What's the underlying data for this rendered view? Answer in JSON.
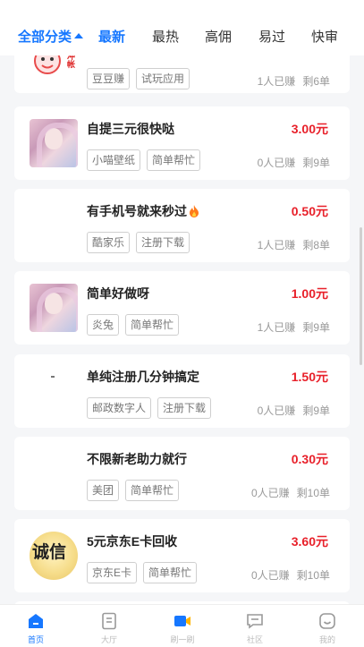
{
  "tabs": {
    "category_label": "全部分类",
    "items": [
      "最新",
      "最热",
      "高佣",
      "易过",
      "快审"
    ]
  },
  "tasks": [
    {
      "title": "",
      "price": "",
      "tags": [
        "豆豆赚",
        "试玩应用"
      ],
      "earned": "1人已赚",
      "remaining": "剩6单",
      "thumb_text": "冲帐"
    },
    {
      "title": "自提三元很快哒",
      "price": "3.00元",
      "tags": [
        "小喵壁纸",
        "简单帮忙"
      ],
      "earned": "0人已赚",
      "remaining": "剩9单"
    },
    {
      "title": "有手机号就来秒过",
      "price": "0.50元",
      "tags": [
        "酷家乐",
        "注册下载"
      ],
      "earned": "1人已赚",
      "remaining": "剩8单"
    },
    {
      "title": "简单好做呀",
      "price": "1.00元",
      "tags": [
        "炎兔",
        "简单帮忙"
      ],
      "earned": "1人已赚",
      "remaining": "剩9单"
    },
    {
      "title": "单纯注册几分钟搞定",
      "price": "1.50元",
      "tags": [
        "邮政数字人",
        "注册下载"
      ],
      "earned": "0人已赚",
      "remaining": "剩9单"
    },
    {
      "title": "不限新老助力就行",
      "price": "0.30元",
      "tags": [
        "美团",
        "简单帮忙"
      ],
      "earned": "0人已赚",
      "remaining": "剩10单"
    },
    {
      "title": "5元京东E卡回收",
      "price": "3.60元",
      "tags": [
        "京东E卡",
        "简单帮忙"
      ],
      "earned": "0人已赚",
      "remaining": "剩10单",
      "thumb_text": "诚信"
    }
  ],
  "tabbar": {
    "items": [
      {
        "label": "首页",
        "icon": "home-icon"
      },
      {
        "label": "大厅",
        "icon": "hall-icon"
      },
      {
        "label": "刷一刷",
        "icon": "video-icon"
      },
      {
        "label": "社区",
        "icon": "community-icon"
      },
      {
        "label": "我的",
        "icon": "profile-icon"
      }
    ]
  },
  "colors": {
    "accent": "#1677ff",
    "price": "#e8202a",
    "background": "#f5f6f8"
  }
}
